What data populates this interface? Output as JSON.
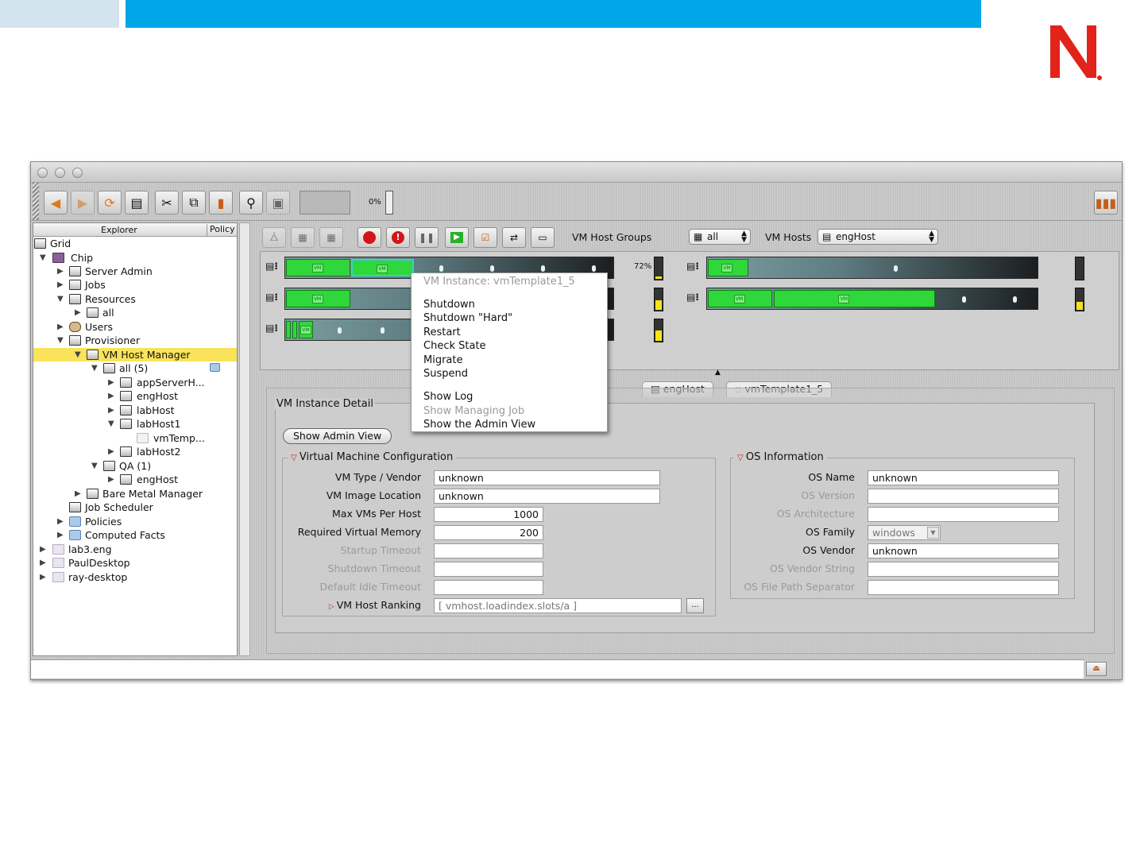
{
  "brand": {
    "logo_letter": "N",
    "brand_color": "#e2231a",
    "accent_blue": "#00a6e8"
  },
  "toolbar": {
    "buttons": [
      "back-icon",
      "forward-icon",
      "refresh-icon",
      "panel-icon",
      "cut-icon",
      "copy-icon",
      "paste-icon",
      "search-icon",
      "save-icon"
    ],
    "progress_label": "0%"
  },
  "explorer": {
    "header_explorer": "Explorer",
    "header_policy": "Policy",
    "tree": [
      {
        "label": "Grid"
      },
      {
        "label": "Chip"
      },
      {
        "label": "Server Admin"
      },
      {
        "label": "Jobs"
      },
      {
        "label": "Resources"
      },
      {
        "label": "all"
      },
      {
        "label": "Users"
      },
      {
        "label": "Provisioner"
      },
      {
        "label": "VM Host Manager"
      },
      {
        "label": "all (5)"
      },
      {
        "label": "appServerH..."
      },
      {
        "label": "engHost"
      },
      {
        "label": "labHost"
      },
      {
        "label": "labHost1"
      },
      {
        "label": "vmTemp..."
      },
      {
        "label": "labHost2"
      },
      {
        "label": "QA (1)"
      },
      {
        "label": "engHost"
      },
      {
        "label": "Bare Metal Manager"
      },
      {
        "label": "Job Scheduler"
      },
      {
        "label": "Policies"
      },
      {
        "label": "Computed Facts"
      },
      {
        "label": "lab3.eng"
      },
      {
        "label": "PaulDesktop"
      },
      {
        "label": "ray-desktop"
      }
    ]
  },
  "vm_controls": {
    "host_groups_label": "VM Host Groups",
    "host_groups_value": "all",
    "hosts_label": "VM Hosts",
    "hosts_value": "engHost",
    "percent_label": "72%"
  },
  "host_meters": [
    0.12,
    0.45,
    0.5,
    0.0,
    0.4
  ],
  "context_menu": {
    "title": "VM Instance: vmTemplate1_5",
    "items": [
      "Shutdown",
      "Shutdown \"Hard\"",
      "Restart",
      "Check State",
      "Migrate",
      "Suspend"
    ],
    "items2": [
      "Show Log",
      "Show Managing Job",
      "Show the Admin View"
    ]
  },
  "tabs": {
    "host_tab": "engHost",
    "vm_tab": "vmTemplate1_5"
  },
  "detail": {
    "panel_title": "VM Instance Detail",
    "admin_button": "Show Admin View",
    "vm_config": {
      "title": "Virtual Machine Configuration",
      "type_label": "VM Type / Vendor",
      "type_value": "unknown",
      "image_label": "VM Image Location",
      "image_value": "unknown",
      "maxvms_label": "Max VMs Per Host",
      "maxvms_value": "1000",
      "memory_label": "Required Virtual Memory",
      "memory_value": "200",
      "startup_label": "Startup Timeout",
      "shutdown_label": "Shutdown Timeout",
      "idle_label": "Default Idle Timeout",
      "ranking_label": "VM Host Ranking",
      "ranking_value": "[ vmhost.loadindex.slots/a ]",
      "browse_label": "..."
    },
    "os_info": {
      "title": "OS Information",
      "name_label": "OS Name",
      "name_value": "unknown",
      "version_label": "OS Version",
      "arch_label": "OS Architecture",
      "family_label": "OS Family",
      "family_value": "windows",
      "vendor_label": "OS Vendor",
      "vendor_value": "unknown",
      "vendor_string_label": "OS Vendor String",
      "path_sep_label": "OS File Path Separator"
    }
  }
}
